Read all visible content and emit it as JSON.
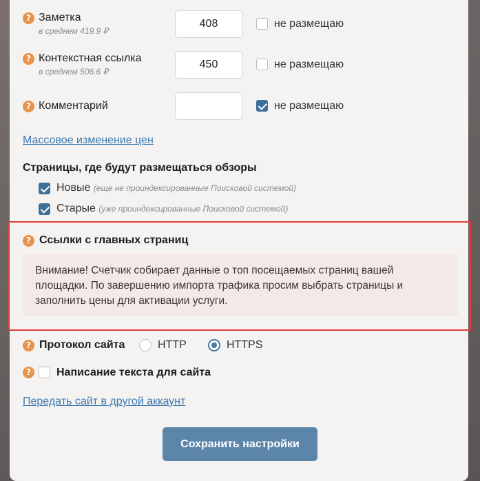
{
  "prices": [
    {
      "label": "Заметка",
      "average": "в среднем 419.9 ₽",
      "value": "408",
      "no_place_label": "не размещаю",
      "no_place_checked": false
    },
    {
      "label": "Контекстная ссылка",
      "average": "в среднем 506.6 ₽",
      "value": "450",
      "no_place_label": "не размещаю",
      "no_place_checked": false
    },
    {
      "label": "Комментарий",
      "average": "",
      "value": "",
      "no_place_label": "не размещаю",
      "no_place_checked": true
    }
  ],
  "bulk_price_link": "Массовое изменение цен",
  "pages_section": {
    "title": "Страницы, где будут размещаться обзоры",
    "options": [
      {
        "label": "Новые",
        "hint": "(еще не проиндексированные Поисковой системой)",
        "checked": true
      },
      {
        "label": "Старые",
        "hint": "(уже проиндексированные Поисковой системой)",
        "checked": true
      }
    ]
  },
  "main_links_section": {
    "title": "Ссылки с главных страниц",
    "notice": "Внимание! Счетчик собирает данные о топ посещаемых страниц вашей площадки. По завершению импорта трафика просим выбрать страницы и заполнить цены для активации услуги."
  },
  "protocol": {
    "label": "Протокол сайта",
    "options": [
      "HTTP",
      "HTTPS"
    ],
    "selected": "HTTPS"
  },
  "text_writing": {
    "label": "Написание текста для сайта",
    "checked": false
  },
  "transfer_link": "Передать сайт в другой аккаунт",
  "save_button": "Сохранить настройки",
  "colors": {
    "accent": "#5b86aa",
    "help_icon": "#e8924a",
    "highlight_border": "#e23b3b",
    "link": "#3d78b2"
  }
}
